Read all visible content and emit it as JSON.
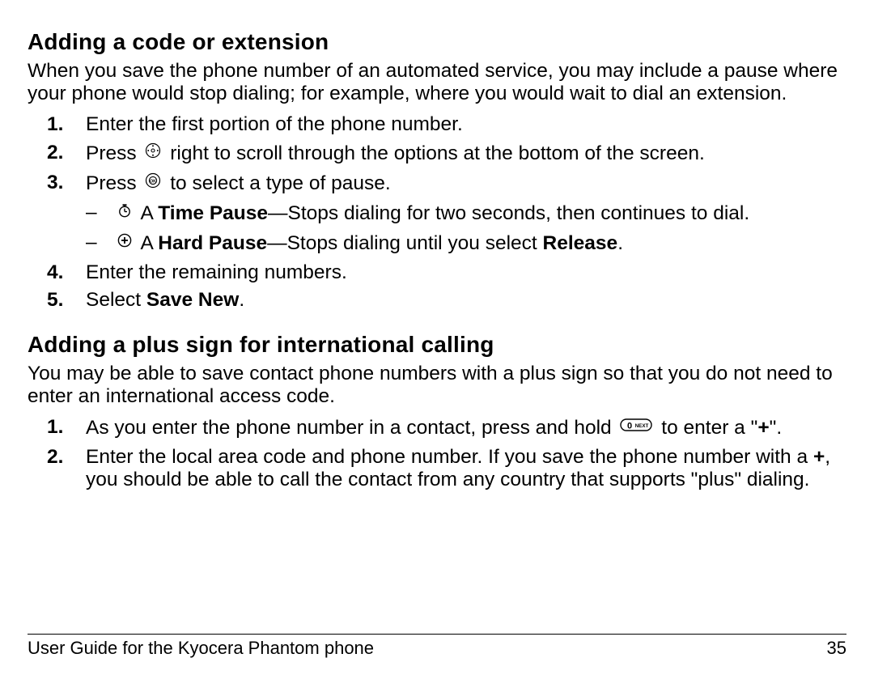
{
  "section1": {
    "title": "Adding a code or extension",
    "intro": "When you save the phone number of an automated service, you may include a pause where your phone would stop dialing; for example, where you would wait to dial an extension.",
    "steps": {
      "s1": "Enter the first portion of the phone number.",
      "s2a": "Press ",
      "s2b": " right to scroll through the options at the bottom of the screen.",
      "s3a": "Press ",
      "s3b": " to select a type of pause.",
      "s3_sub1_a": " A ",
      "s3_sub1_b": "Time Pause",
      "s3_sub1_c": "—Stops dialing for two seconds, then continues to dial.",
      "s3_sub2_a": " A ",
      "s3_sub2_b": "Hard Pause",
      "s3_sub2_c": "—Stops dialing until you select ",
      "s3_sub2_d": "Release",
      "s3_sub2_e": ".",
      "s4": "Enter the remaining numbers.",
      "s5a": "Select ",
      "s5b": "Save New",
      "s5c": "."
    }
  },
  "section2": {
    "title": "Adding a plus sign for international calling",
    "intro": "You may be able to save contact phone numbers with a plus sign so that you do not need to enter an international access code.",
    "steps": {
      "s1a": "As you enter the phone number in a contact, press and hold ",
      "s1b": " to enter a \"",
      "s1c": "+",
      "s1d": "\".",
      "s2a": "Enter the local area code and phone number. If you save the phone number with a ",
      "s2b": "+",
      "s2c": ", you should be able to call the contact from any country that supports \"plus\" dialing."
    }
  },
  "footer": {
    "left": "User Guide for the Kyocera Phantom phone",
    "right": "35"
  },
  "icons": {
    "nav": "nav-key-icon",
    "ok": "ok-key-icon",
    "timer": "timer-icon",
    "plus_circle": "plus-icon",
    "zero_next": "zero-next-key-icon"
  }
}
